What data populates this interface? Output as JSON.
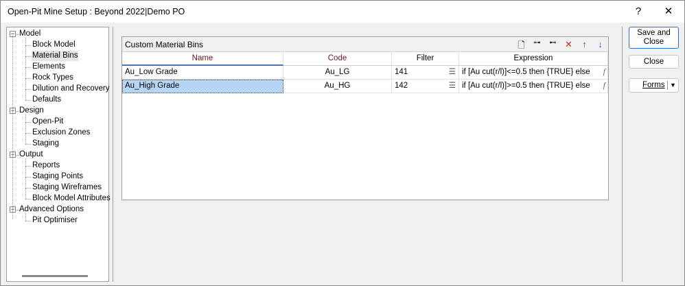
{
  "window": {
    "title": "Open-Pit Mine Setup : Beyond 2022|Demo PO",
    "help": "?",
    "close": "✕"
  },
  "tree": [
    {
      "label": "Model",
      "children": [
        "Block Model",
        "Material Bins",
        "Elements",
        "Rock Types",
        "Dilution and Recovery",
        "Defaults"
      ]
    },
    {
      "label": "Design",
      "children": [
        "Open-Pit",
        "Exclusion Zones",
        "Staging"
      ]
    },
    {
      "label": "Output",
      "children": [
        "Reports",
        "Staging Points",
        "Staging Wireframes",
        "Block Model Attributes"
      ]
    },
    {
      "label": "Advanced Options",
      "children": [
        "Pit Optimiser"
      ]
    }
  ],
  "tree_selected": "Material Bins",
  "grid": {
    "title": "Custom Material Bins",
    "columns": [
      "Name",
      "Code",
      "Filter",
      "Expression"
    ],
    "rows": [
      {
        "name": "Au_Low Grade",
        "code": "Au_LG",
        "filter": "141",
        "expression": "if [Au cut(r/l)]<=0.5 then {TRUE} else"
      },
      {
        "name": "Au_High Grade",
        "code": "Au_HG",
        "filter": "142",
        "expression": "if [Au cut(r/l)]>=0.5 then {TRUE} else"
      }
    ],
    "selected_row": 1
  },
  "buttons": {
    "save_close": "Save and Close",
    "close": "Close",
    "forms": "Forms"
  }
}
